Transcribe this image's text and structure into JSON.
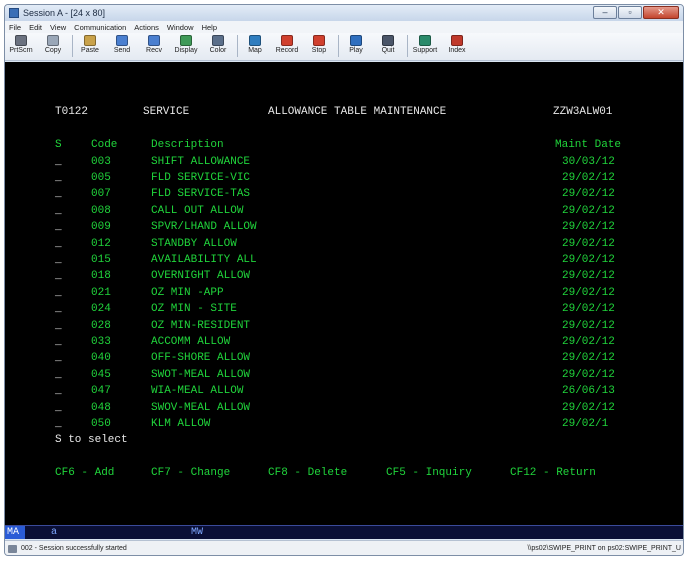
{
  "window": {
    "title": "Session A - [24 x 80]",
    "buttons": {
      "minimize": "–",
      "maximize": "▫",
      "close": "✕"
    }
  },
  "menu": [
    "File",
    "Edit",
    "View",
    "Communication",
    "Actions",
    "Window",
    "Help"
  ],
  "toolbar": [
    {
      "label": "PrtScrn",
      "icon": "printer-icon",
      "color": "#6b7280"
    },
    {
      "label": "Copy",
      "icon": "copy-icon",
      "color": "#9aa7b8"
    },
    {
      "label": "Paste",
      "icon": "paste-icon",
      "color": "#c9a24a"
    },
    {
      "label": "Send",
      "icon": "send-icon",
      "color": "#4a7fd0"
    },
    {
      "label": "Recv",
      "icon": "receive-icon",
      "color": "#4a7fd0"
    },
    {
      "label": "Display",
      "icon": "display-icon",
      "color": "#3f9a58"
    },
    {
      "label": "Color",
      "icon": "color-icon",
      "color": "#5b6f8a"
    },
    {
      "label": "Map",
      "icon": "map-icon",
      "color": "#2f7dbf"
    },
    {
      "label": "Record",
      "icon": "record-icon",
      "color": "#d0402e"
    },
    {
      "label": "Stop",
      "icon": "stop-icon",
      "color": "#d0402e"
    },
    {
      "label": "Play",
      "icon": "play-icon",
      "color": "#2f6fbf"
    },
    {
      "label": "Quit",
      "icon": "quit-icon",
      "color": "#4a5568"
    },
    {
      "label": "Support",
      "icon": "support-icon",
      "color": "#2a8a6a"
    },
    {
      "label": "Index",
      "icon": "index-icon",
      "color": "#c0392b"
    }
  ],
  "screen": {
    "header": {
      "id": "T0122",
      "module": "SERVICE",
      "title": "ALLOWANCE TABLE MAINTENANCE",
      "program": "ZZW3ALW01"
    },
    "columns": {
      "select": "S",
      "code": "Code",
      "description": "Description",
      "maint_date": "Maint Date"
    },
    "rows": [
      {
        "sel": "_",
        "code": "003",
        "description": "SHIFT ALLOWANCE",
        "date": "30/03/12"
      },
      {
        "sel": "_",
        "code": "005",
        "description": "FLD SERVICE-VIC",
        "date": "29/02/12"
      },
      {
        "sel": "_",
        "code": "007",
        "description": "FLD SERVICE-TAS",
        "date": "29/02/12"
      },
      {
        "sel": "_",
        "code": "008",
        "description": "CALL OUT ALLOW",
        "date": "29/02/12"
      },
      {
        "sel": "_",
        "code": "009",
        "description": "SPVR/LHAND ALLOW",
        "date": "29/02/12"
      },
      {
        "sel": "_",
        "code": "012",
        "description": "STANDBY ALLOW",
        "date": "29/02/12"
      },
      {
        "sel": "_",
        "code": "015",
        "description": "AVAILABILITY ALL",
        "date": "29/02/12"
      },
      {
        "sel": "_",
        "code": "018",
        "description": "OVERNIGHT ALLOW",
        "date": "29/02/12"
      },
      {
        "sel": "_",
        "code": "021",
        "description": "OZ MIN -APP",
        "date": "29/02/12"
      },
      {
        "sel": "_",
        "code": "024",
        "description": "OZ MIN - SITE",
        "date": "29/02/12"
      },
      {
        "sel": "_",
        "code": "028",
        "description": "OZ MIN-RESIDENT",
        "date": "29/02/12"
      },
      {
        "sel": "_",
        "code": "033",
        "description": "ACCOMM ALLOW",
        "date": "29/02/12"
      },
      {
        "sel": "_",
        "code": "040",
        "description": "OFF-SHORE ALLOW",
        "date": "29/02/12"
      },
      {
        "sel": "_",
        "code": "045",
        "description": "SWOT-MEAL ALLOW",
        "date": "29/02/12"
      },
      {
        "sel": "_",
        "code": "047",
        "description": "WIA-MEAL ALLOW",
        "date": "26/06/13"
      },
      {
        "sel": "_",
        "code": "048",
        "description": "SWOV-MEAL ALLOW",
        "date": "29/02/12"
      },
      {
        "sel": "_",
        "code": "050",
        "description": "KLM ALLOW",
        "date": "29/02/1"
      }
    ],
    "instruction": "S to select",
    "function_keys": [
      "CF6 - Add",
      "CF7 - Change",
      "CF8 - Delete",
      "CF5 - Inquiry",
      "CF12 - Return"
    ],
    "colors": {
      "green": "#20d43b",
      "white": "#e8e8e8",
      "cyan": "#4fd8e8"
    }
  },
  "oia": {
    "indicator": "MA",
    "field2": "a",
    "field3": "MW"
  },
  "status": {
    "message": "002 - Session successfully started",
    "printer": "\\\\ps02\\SWIPE_PRINT on ps02:SWIPE_PRINT_U"
  }
}
